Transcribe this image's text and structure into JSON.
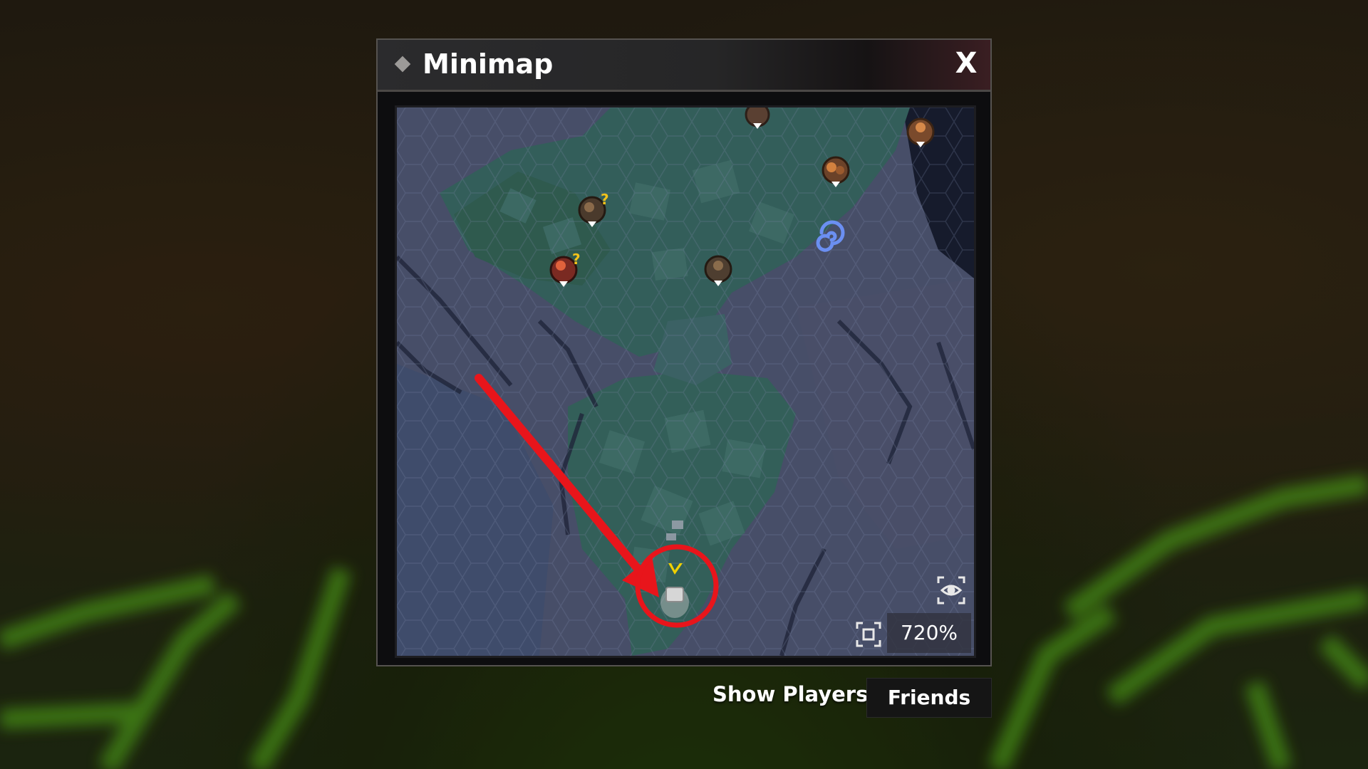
{
  "minimap": {
    "title": "Minimap",
    "close_label": "X",
    "zoom_level": "720%"
  },
  "show_players": {
    "label": "Show Players:",
    "selected": "Friends"
  },
  "icons": {
    "title": "diamond-icon",
    "recenter": "eye-target-icon",
    "focus": "focus-frame-icon",
    "portal": "swirl-portal-icon",
    "player": "player-marker-icon"
  },
  "colors": {
    "annotation": "#e8151b",
    "player_marker": "#f0d000",
    "portal": "#6b8ff2"
  }
}
